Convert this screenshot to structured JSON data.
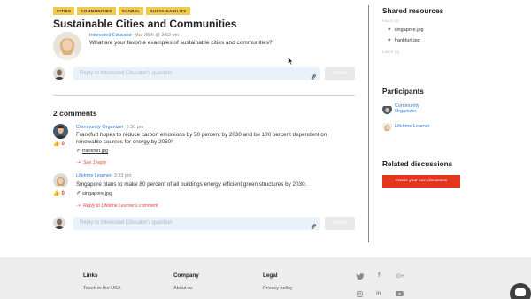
{
  "tags": [
    "CITIES",
    "COMMUNITIES",
    "GLOBAL",
    "SUSTAINABILITY"
  ],
  "discussion": {
    "title": "Sustainable Cities and Communities",
    "author": "Interested Educator",
    "time": "Mar 26th @ 2:52 pm",
    "question": "What are your favorite examples of sustainable cities and communities?"
  },
  "reply_box": {
    "placeholder": "Reply to Interested Educator's question",
    "submit_label": "Submit"
  },
  "comments_title": "2 comments",
  "comments": [
    {
      "author": "Community Organizer",
      "time": "3:30 pm",
      "text": "Frankfurt hopes to reduce carbon emissions by 50 percent by 2030 and be 100 percent dependent on renewable sources for energy by 2050!",
      "likes": "0",
      "attachment": "frankfurt.jpg",
      "reply_link": "See 1 reply"
    },
    {
      "author": "Lifetime Learner",
      "time": "3:33 pm",
      "text": "Singapore plans to make 80 percent of all buildings energy efficient green structures by 2030.",
      "likes": "0",
      "attachment": "singapore.jpg",
      "reply_link": "Reply to Lifetime Learner's comment"
    }
  ],
  "sidebar": {
    "shared_resources_title": "Shared resources",
    "files_label": "FILES (2)",
    "files": [
      "singapore.jpg",
      "frankfurt.jpg"
    ],
    "links_label": "LINKS (0)",
    "participants_title": "Participants",
    "participants": [
      "Community Organizer",
      "Lifetime Learner"
    ],
    "related_title": "Related discussions",
    "create_button": "Create your own discussion"
  },
  "footer": {
    "links_title": "Links",
    "links_item": "Teach in the USA",
    "company_title": "Company",
    "company_item": "About us",
    "legal_title": "Legal",
    "legal_item": "Privacy policy",
    "social_icons": [
      "twitter-icon",
      "facebook-icon",
      "google-plus-icon",
      "instagram-icon",
      "linkedin-icon",
      "youtube-icon"
    ]
  },
  "colors": {
    "tag": "#f2c94c",
    "link": "#2d7bd6",
    "accent": "#e4361f",
    "reply_input": "#e9f1fb"
  }
}
